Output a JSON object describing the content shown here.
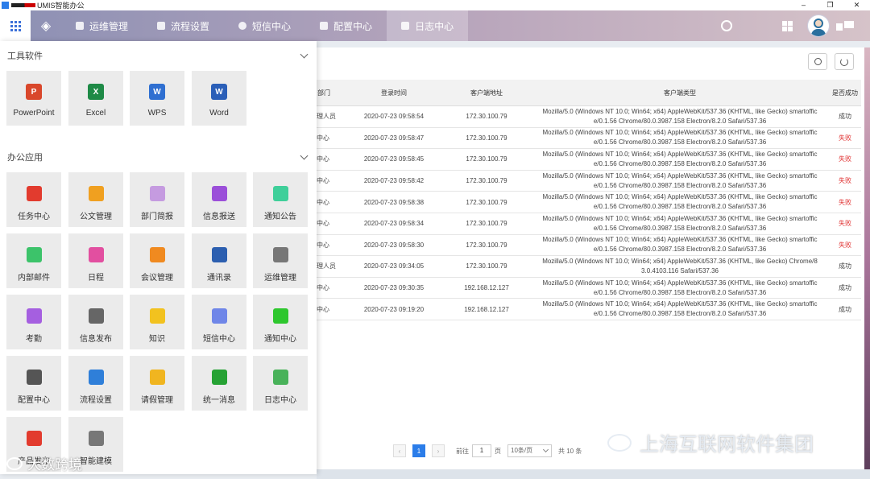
{
  "window": {
    "title": "UMIS智能办公",
    "controls": [
      "–",
      "❐",
      "✕"
    ]
  },
  "nav": {
    "items": [
      {
        "label": "运维管理",
        "active": false
      },
      {
        "label": "流程设置",
        "active": false
      },
      {
        "label": "短信中心",
        "active": false
      },
      {
        "label": "配置中心",
        "active": false
      },
      {
        "label": "日志中心",
        "active": true
      }
    ]
  },
  "launcher": {
    "tools_title": "工具软件",
    "tools": [
      {
        "label": "PowerPoint",
        "color": "#d9472b",
        "glyph": "P"
      },
      {
        "label": "Excel",
        "color": "#1e8a46",
        "glyph": "X"
      },
      {
        "label": "WPS",
        "color": "#2f6fd1",
        "glyph": "W"
      },
      {
        "label": "Word",
        "color": "#2b5fb8",
        "glyph": "W"
      }
    ],
    "office_title": "办公应用",
    "apps": [
      {
        "label": "任务中心",
        "color": "#e23b2e",
        "icon": "task-icon"
      },
      {
        "label": "公文管理",
        "color": "#f0a020",
        "icon": "briefcase-icon"
      },
      {
        "label": "部门简报",
        "color": "#c59be0",
        "icon": "report-icon"
      },
      {
        "label": "信息报送",
        "color": "#9b4fd9",
        "icon": "doc-icon"
      },
      {
        "label": "通知公告",
        "color": "#3fcf9a",
        "icon": "speaker-icon"
      },
      {
        "label": "内部邮件",
        "color": "#3cc36a",
        "icon": "mail-icon"
      },
      {
        "label": "日程",
        "color": "#e24fa0",
        "icon": "calendar-icon"
      },
      {
        "label": "会议管理",
        "color": "#f08a20",
        "icon": "meeting-icon"
      },
      {
        "label": "通讯录",
        "color": "#2c5fb0",
        "icon": "contacts-icon"
      },
      {
        "label": "运维管理",
        "color": "#777777",
        "icon": "ops-icon"
      },
      {
        "label": "考勤",
        "color": "#a55fe0",
        "icon": "location-icon"
      },
      {
        "label": "信息发布",
        "color": "#666666",
        "icon": "publish-icon"
      },
      {
        "label": "知识",
        "color": "#f2c21f",
        "icon": "knowledge-icon"
      },
      {
        "label": "短信中心",
        "color": "#6f86e8",
        "icon": "sms-icon"
      },
      {
        "label": "通知中心",
        "color": "#2ec72e",
        "icon": "notice-icon"
      },
      {
        "label": "配置中心",
        "color": "#555555",
        "icon": "config-icon"
      },
      {
        "label": "流程设置",
        "color": "#2f7fd9",
        "icon": "flow-icon"
      },
      {
        "label": "请假管理",
        "color": "#f0b520",
        "icon": "leave-icon"
      },
      {
        "label": "统一消息",
        "color": "#26a234",
        "icon": "message-icon"
      },
      {
        "label": "日志中心",
        "color": "#49b25a",
        "icon": "log-icon"
      },
      {
        "label": "产品发布",
        "color": "#e23b2e",
        "icon": "product-icon"
      },
      {
        "label": "智能建模",
        "color": "#777777",
        "icon": "model-icon"
      }
    ]
  },
  "table": {
    "columns": [
      "部门",
      "登录时间",
      "客户端地址",
      "客户端类型",
      "是否成功"
    ],
    "rows": [
      {
        "dept": "理人员",
        "time": "2020-07-23 09:58:54",
        "ip": "172.30.100.79",
        "ua1": "Mozilla/5.0 (Windows NT 10.0; Win64; x64) AppleWebKit/537.36 (KHTML, like Gecko) smartoffic",
        "ua2": "e/0.1.56 Chrome/80.0.3987.158 Electron/8.2.0 Safari/537.36",
        "ok": "成功"
      },
      {
        "dept": "中心",
        "time": "2020-07-23 09:58:47",
        "ip": "172.30.100.79",
        "ua1": "Mozilla/5.0 (Windows NT 10.0; Win64; x64) AppleWebKit/537.36 (KHTML, like Gecko) smartoffic",
        "ua2": "e/0.1.56 Chrome/80.0.3987.158 Electron/8.2.0 Safari/537.36",
        "ok": "失败"
      },
      {
        "dept": "中心",
        "time": "2020-07-23 09:58:45",
        "ip": "172.30.100.79",
        "ua1": "Mozilla/5.0 (Windows NT 10.0; Win64; x64) AppleWebKit/537.36 (KHTML, like Gecko) smartoffic",
        "ua2": "e/0.1.56 Chrome/80.0.3987.158 Electron/8.2.0 Safari/537.36",
        "ok": "失败"
      },
      {
        "dept": "中心",
        "time": "2020-07-23 09:58:42",
        "ip": "172.30.100.79",
        "ua1": "Mozilla/5.0 (Windows NT 10.0; Win64; x64) AppleWebKit/537.36 (KHTML, like Gecko) smartoffic",
        "ua2": "e/0.1.56 Chrome/80.0.3987.158 Electron/8.2.0 Safari/537.36",
        "ok": "失败"
      },
      {
        "dept": "中心",
        "time": "2020-07-23 09:58:38",
        "ip": "172.30.100.79",
        "ua1": "Mozilla/5.0 (Windows NT 10.0; Win64; x64) AppleWebKit/537.36 (KHTML, like Gecko) smartoffic",
        "ua2": "e/0.1.56 Chrome/80.0.3987.158 Electron/8.2.0 Safari/537.36",
        "ok": "失败"
      },
      {
        "dept": "中心",
        "time": "2020-07-23 09:58:34",
        "ip": "172.30.100.79",
        "ua1": "Mozilla/5.0 (Windows NT 10.0; Win64; x64) AppleWebKit/537.36 (KHTML, like Gecko) smartoffic",
        "ua2": "e/0.1.56 Chrome/80.0.3987.158 Electron/8.2.0 Safari/537.36",
        "ok": "失败"
      },
      {
        "dept": "中心",
        "time": "2020-07-23 09:58:30",
        "ip": "172.30.100.79",
        "ua1": "Mozilla/5.0 (Windows NT 10.0; Win64; x64) AppleWebKit/537.36 (KHTML, like Gecko) smartoffic",
        "ua2": "e/0.1.56 Chrome/80.0.3987.158 Electron/8.2.0 Safari/537.36",
        "ok": "失败"
      },
      {
        "dept": "理人员",
        "time": "2020-07-23 09:34:05",
        "ip": "172.30.100.79",
        "ua1": "Mozilla/5.0 (Windows NT 10.0; Win64; x64) AppleWebKit/537.36 (KHTML, like Gecko) Chrome/8",
        "ua2": "3.0.4103.116 Safari/537.36",
        "ok": "成功"
      },
      {
        "dept": "中心",
        "time": "2020-07-23 09:30:35",
        "ip": "192.168.12.127",
        "ua1": "Mozilla/5.0 (Windows NT 10.0; Win64; x64) AppleWebKit/537.36 (KHTML, like Gecko) smartoffic",
        "ua2": "e/0.1.56 Chrome/80.0.3987.158 Electron/8.2.0 Safari/537.36",
        "ok": "成功"
      },
      {
        "dept": "中心",
        "time": "2020-07-23 09:19:20",
        "ip": "192.168.12.127",
        "ua1": "Mozilla/5.0 (Windows NT 10.0; Win64; x64) AppleWebKit/537.36 (KHTML, like Gecko) smartoffic",
        "ua2": "e/0.1.56 Chrome/80.0.3987.158 Electron/8.2.0 Safari/537.36",
        "ok": "成功"
      }
    ]
  },
  "pager": {
    "prev": "‹",
    "current": "1",
    "next": "›",
    "goto_label": "前往",
    "page_value": "1",
    "page_unit": "页",
    "page_size": "10条/页",
    "total": "共 10 条"
  },
  "watermarks": {
    "left": "大数跨境",
    "right": "上海互联网软件集团"
  },
  "colors": {
    "accent": "#2b7de9",
    "fail": "#e03030"
  }
}
